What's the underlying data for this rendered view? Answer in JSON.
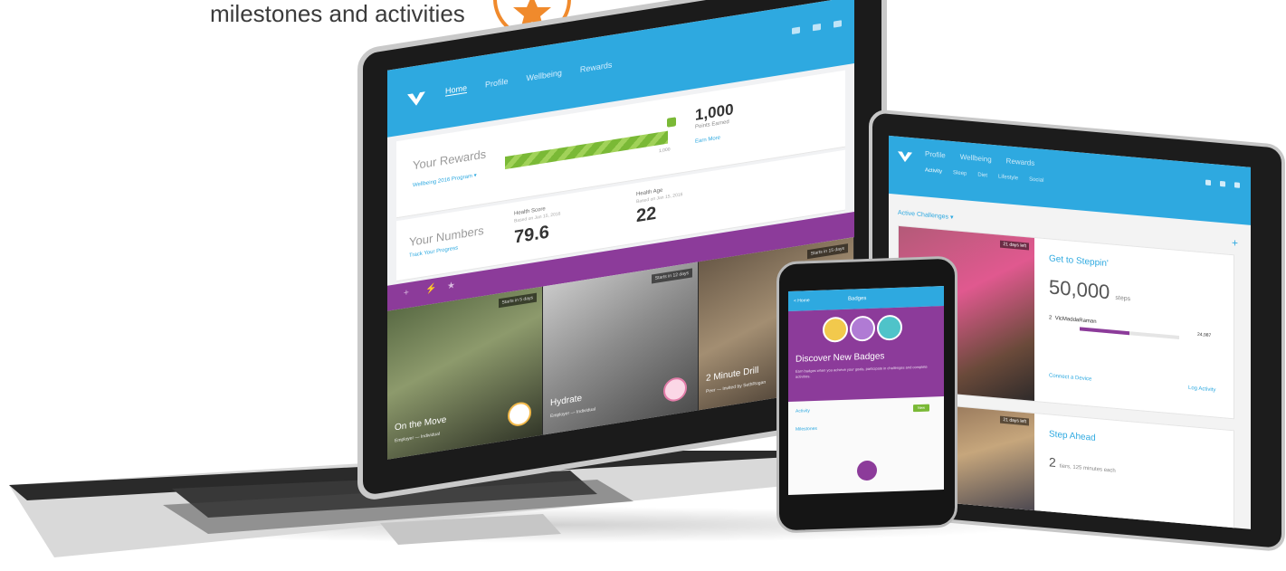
{
  "caption": "milestones and activities",
  "laptop": {
    "nav": {
      "tabs": [
        "Home",
        "Profile",
        "Wellbeing",
        "Rewards"
      ],
      "active_tab": "Home"
    },
    "rewards": {
      "title": "Your Rewards",
      "program_link": "Wellbeing 2016 Program ▾",
      "progress_label": "1,000",
      "progress_fraction": 0.9,
      "points": "1,000",
      "points_label": "Points Earned",
      "earn_link": "Earn More"
    },
    "numbers": {
      "title": "Your Numbers",
      "link": "Track Your Progress",
      "health_score_label": "Health Score",
      "health_score_sub": "Based on Jan 15, 2016",
      "health_score": "79.6",
      "health_age_label": "Health Age",
      "health_age_sub": "Based on Jan 15, 2016",
      "health_age": "22"
    },
    "tiles": [
      {
        "title": "On the Move",
        "sub": "Employer — Individual",
        "badge": "Starts in 5 days"
      },
      {
        "title": "Hydrate",
        "sub": "Employer — Individual",
        "badge": "Starts in 12 days"
      },
      {
        "title": "2 Minute Drill",
        "sub": "Peer — Invited by SethRogan",
        "badge": "Starts in 15 days"
      }
    ]
  },
  "tablet": {
    "nav": {
      "tabs": [
        "Profile",
        "Wellbeing",
        "Rewards"
      ],
      "subtabs": [
        "Activity",
        "Sleep",
        "Diet",
        "Lifestyle",
        "Social"
      ],
      "active_subtab": "Activity"
    },
    "active_challenges": "Active Challenges ▾",
    "plus": "+",
    "challenge1": {
      "title": "Get to Steppin'",
      "steps": "50,000",
      "steps_unit": "steps",
      "rank": "2",
      "participant": "VicMaddaRaman",
      "count": "24,987",
      "progress_fraction": 0.5,
      "days": "21 days left",
      "connect": "Connect a Device",
      "log": "Log Activity"
    },
    "challenge2": {
      "title": "Step Ahead",
      "detail_num": "2",
      "detail_unit": "tiers, 125 minutes each",
      "days": "21 days left"
    }
  },
  "phone": {
    "back": "< Home",
    "title": "Badges",
    "heading": "Discover New Badges",
    "description": "Earn badges when you achieve your goals, participate in challenges and complete activities.",
    "row1": "Activity",
    "row2": "Milestones",
    "new_label": "New"
  },
  "colors": {
    "blue": "#2ea9e0",
    "purple": "#8c3b9a",
    "green": "#7ab936",
    "orange": "#f08a2c"
  }
}
